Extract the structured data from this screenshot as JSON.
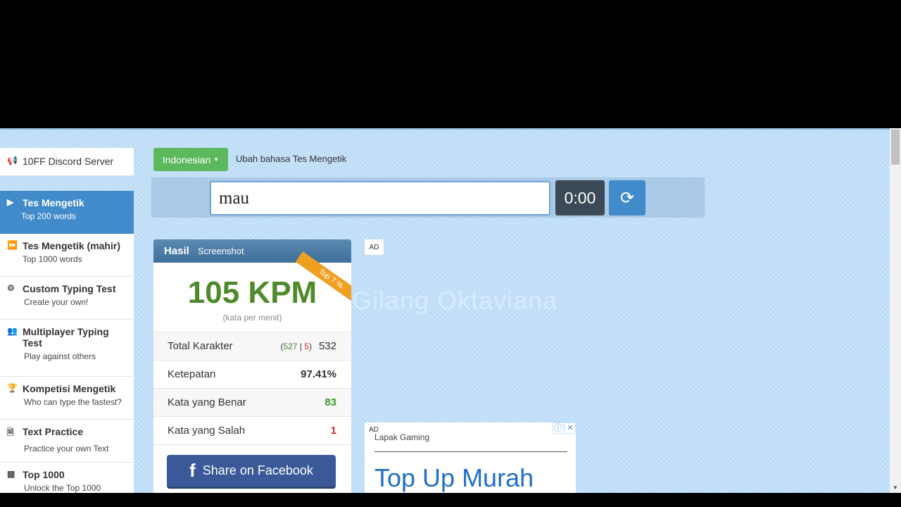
{
  "sidebar": {
    "items": [
      {
        "label": "10FF Discord Server",
        "icon": "megaphone-icon"
      },
      {
        "label": "Tes Mengetik",
        "sub": "Top 200 words",
        "icon": "play-icon"
      },
      {
        "label": "Tes Mengetik (mahir)",
        "sub": "Top 1000 words",
        "icon": "fast-forward-icon"
      },
      {
        "label": "Custom Typing Test",
        "sub": "Create your own!",
        "icon": "gears-icon"
      },
      {
        "label": "Multiplayer Typing Test",
        "sub": "Play against others",
        "icon": "users-icon"
      },
      {
        "label": "Kompetisi Mengetik",
        "sub": "Who can type the fastest?",
        "icon": "trophy-icon"
      },
      {
        "label": "Text Practice",
        "sub": "Practice your own Text",
        "icon": "document-icon"
      },
      {
        "label": "Top 1000",
        "sub": "Unlock the Top 1000",
        "icon": "bar-chart-icon"
      }
    ]
  },
  "language": {
    "selected": "Indonesian",
    "label": "Ubah bahasa Tes Mengetik"
  },
  "typing": {
    "input_value": "mau",
    "timer": "0:00"
  },
  "result": {
    "header_title": "Hasil",
    "header_link": "Screenshot",
    "badge": "Top 7 %",
    "wpm": "105 KPM",
    "wpm_sub": "(kata per menit)",
    "stats": {
      "total_karakter": {
        "label": "Total Karakter",
        "correct": "527",
        "separator": "|",
        "wrong": "5",
        "total": "532"
      },
      "ketepatan": {
        "label": "Ketepatan",
        "value": "97.41%"
      },
      "kata_benar": {
        "label": "Kata yang Benar",
        "value": "83"
      },
      "kata_salah": {
        "label": "Kata yang Salah",
        "value": "1"
      }
    },
    "share_label": "Share on Facebook",
    "share_icon_glyph": "f"
  },
  "watermark": "Gilang Oktaviana",
  "ads": {
    "badge_top": "AD",
    "box_tag": "AD",
    "brand": "Lapak Gaming",
    "headline": "Top Up Murah"
  },
  "colors": {
    "accent": "#428bca",
    "green_button": "#5cb85c",
    "wpm_green": "#4e8a2b",
    "facebook": "#3b5998",
    "ribbon": "#f0a020"
  }
}
